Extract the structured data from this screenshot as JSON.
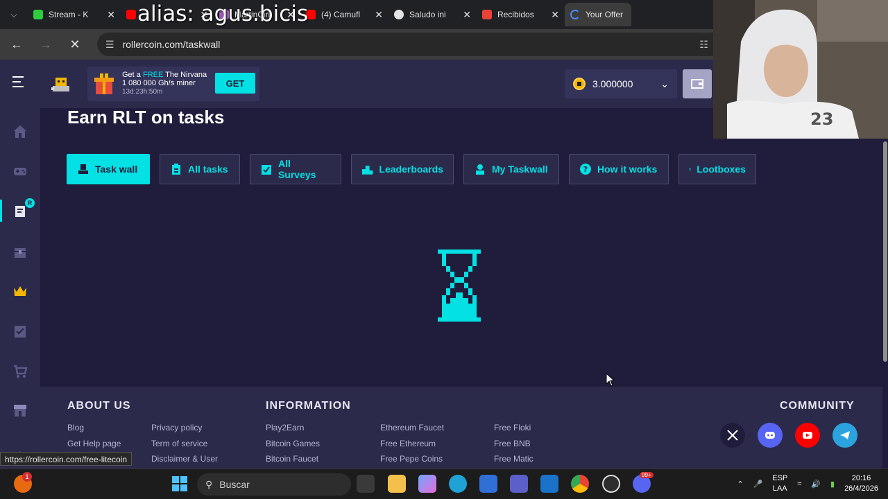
{
  "browser": {
    "tabs": [
      {
        "title": "Stream - K",
        "color": "#2ecc40"
      },
      {
        "title": "",
        "color": "#ff0000"
      },
      {
        "title": "MartinCiri",
        "color": "#9b59b6"
      },
      {
        "title": "(4) Camufl",
        "color": "#ff0000"
      },
      {
        "title": "Saludo ini",
        "color": "#e3e3e3"
      },
      {
        "title": "Recibidos",
        "color": "#ea4335"
      },
      {
        "title": "Your Offer",
        "color": "#4c8bf5"
      }
    ],
    "overlay_text": "alias: agus.bicis",
    "url": "rollercoin.com/taskwall",
    "status_url": "https://rollercoin.com/free-litecoin"
  },
  "header": {
    "promo_line1_a": "Get a ",
    "promo_free": "FREE",
    "promo_line1_b": " The Nirvana",
    "promo_line2": "1 080 000 Gh/s miner",
    "promo_timer": "13d:23h:50m",
    "promo_button": "GET",
    "balance": "3.000000"
  },
  "sidebar": {
    "badge": "R",
    "items": [
      "home-icon",
      "game-icon",
      "tasks-icon",
      "chest-icon",
      "crown-icon",
      "checklist-icon",
      "cart-icon",
      "store-icon"
    ]
  },
  "main": {
    "title": "Earn RLT on tasks",
    "tabs": [
      "Task wall",
      "All tasks",
      "All Surveys",
      "Leaderboards",
      "My Taskwall",
      "How it works",
      "Lootboxes"
    ]
  },
  "footer": {
    "about_heading": "ABOUT US",
    "info_heading": "INFORMATION",
    "community_heading": "COMMUNITY",
    "about_col1": [
      "Blog",
      "Get Help page"
    ],
    "about_col2": [
      "Privacy policy",
      "Term of service",
      "Disclaimer & User"
    ],
    "info_col1": [
      "Play2Earn",
      "Bitcoin Games",
      "Bitcoin Faucet"
    ],
    "info_col2": [
      "Ethereum Faucet",
      "Free Ethereum",
      "Free Pepe Coins"
    ],
    "info_col3": [
      "Free Floki",
      "Free BNB",
      "Free Matic"
    ]
  },
  "taskbar": {
    "notif_count": "1",
    "search_placeholder": "Buscar",
    "lang_1": "ESP",
    "lang_2": "LAA",
    "time": "20:16",
    "date": "26/4/2026",
    "badge_99": "99+"
  },
  "webcam": {
    "jersey_number": "23"
  },
  "colors": {
    "accent": "#03e1e4",
    "background": "#1f1d3b",
    "panel": "#2b2a4b"
  }
}
